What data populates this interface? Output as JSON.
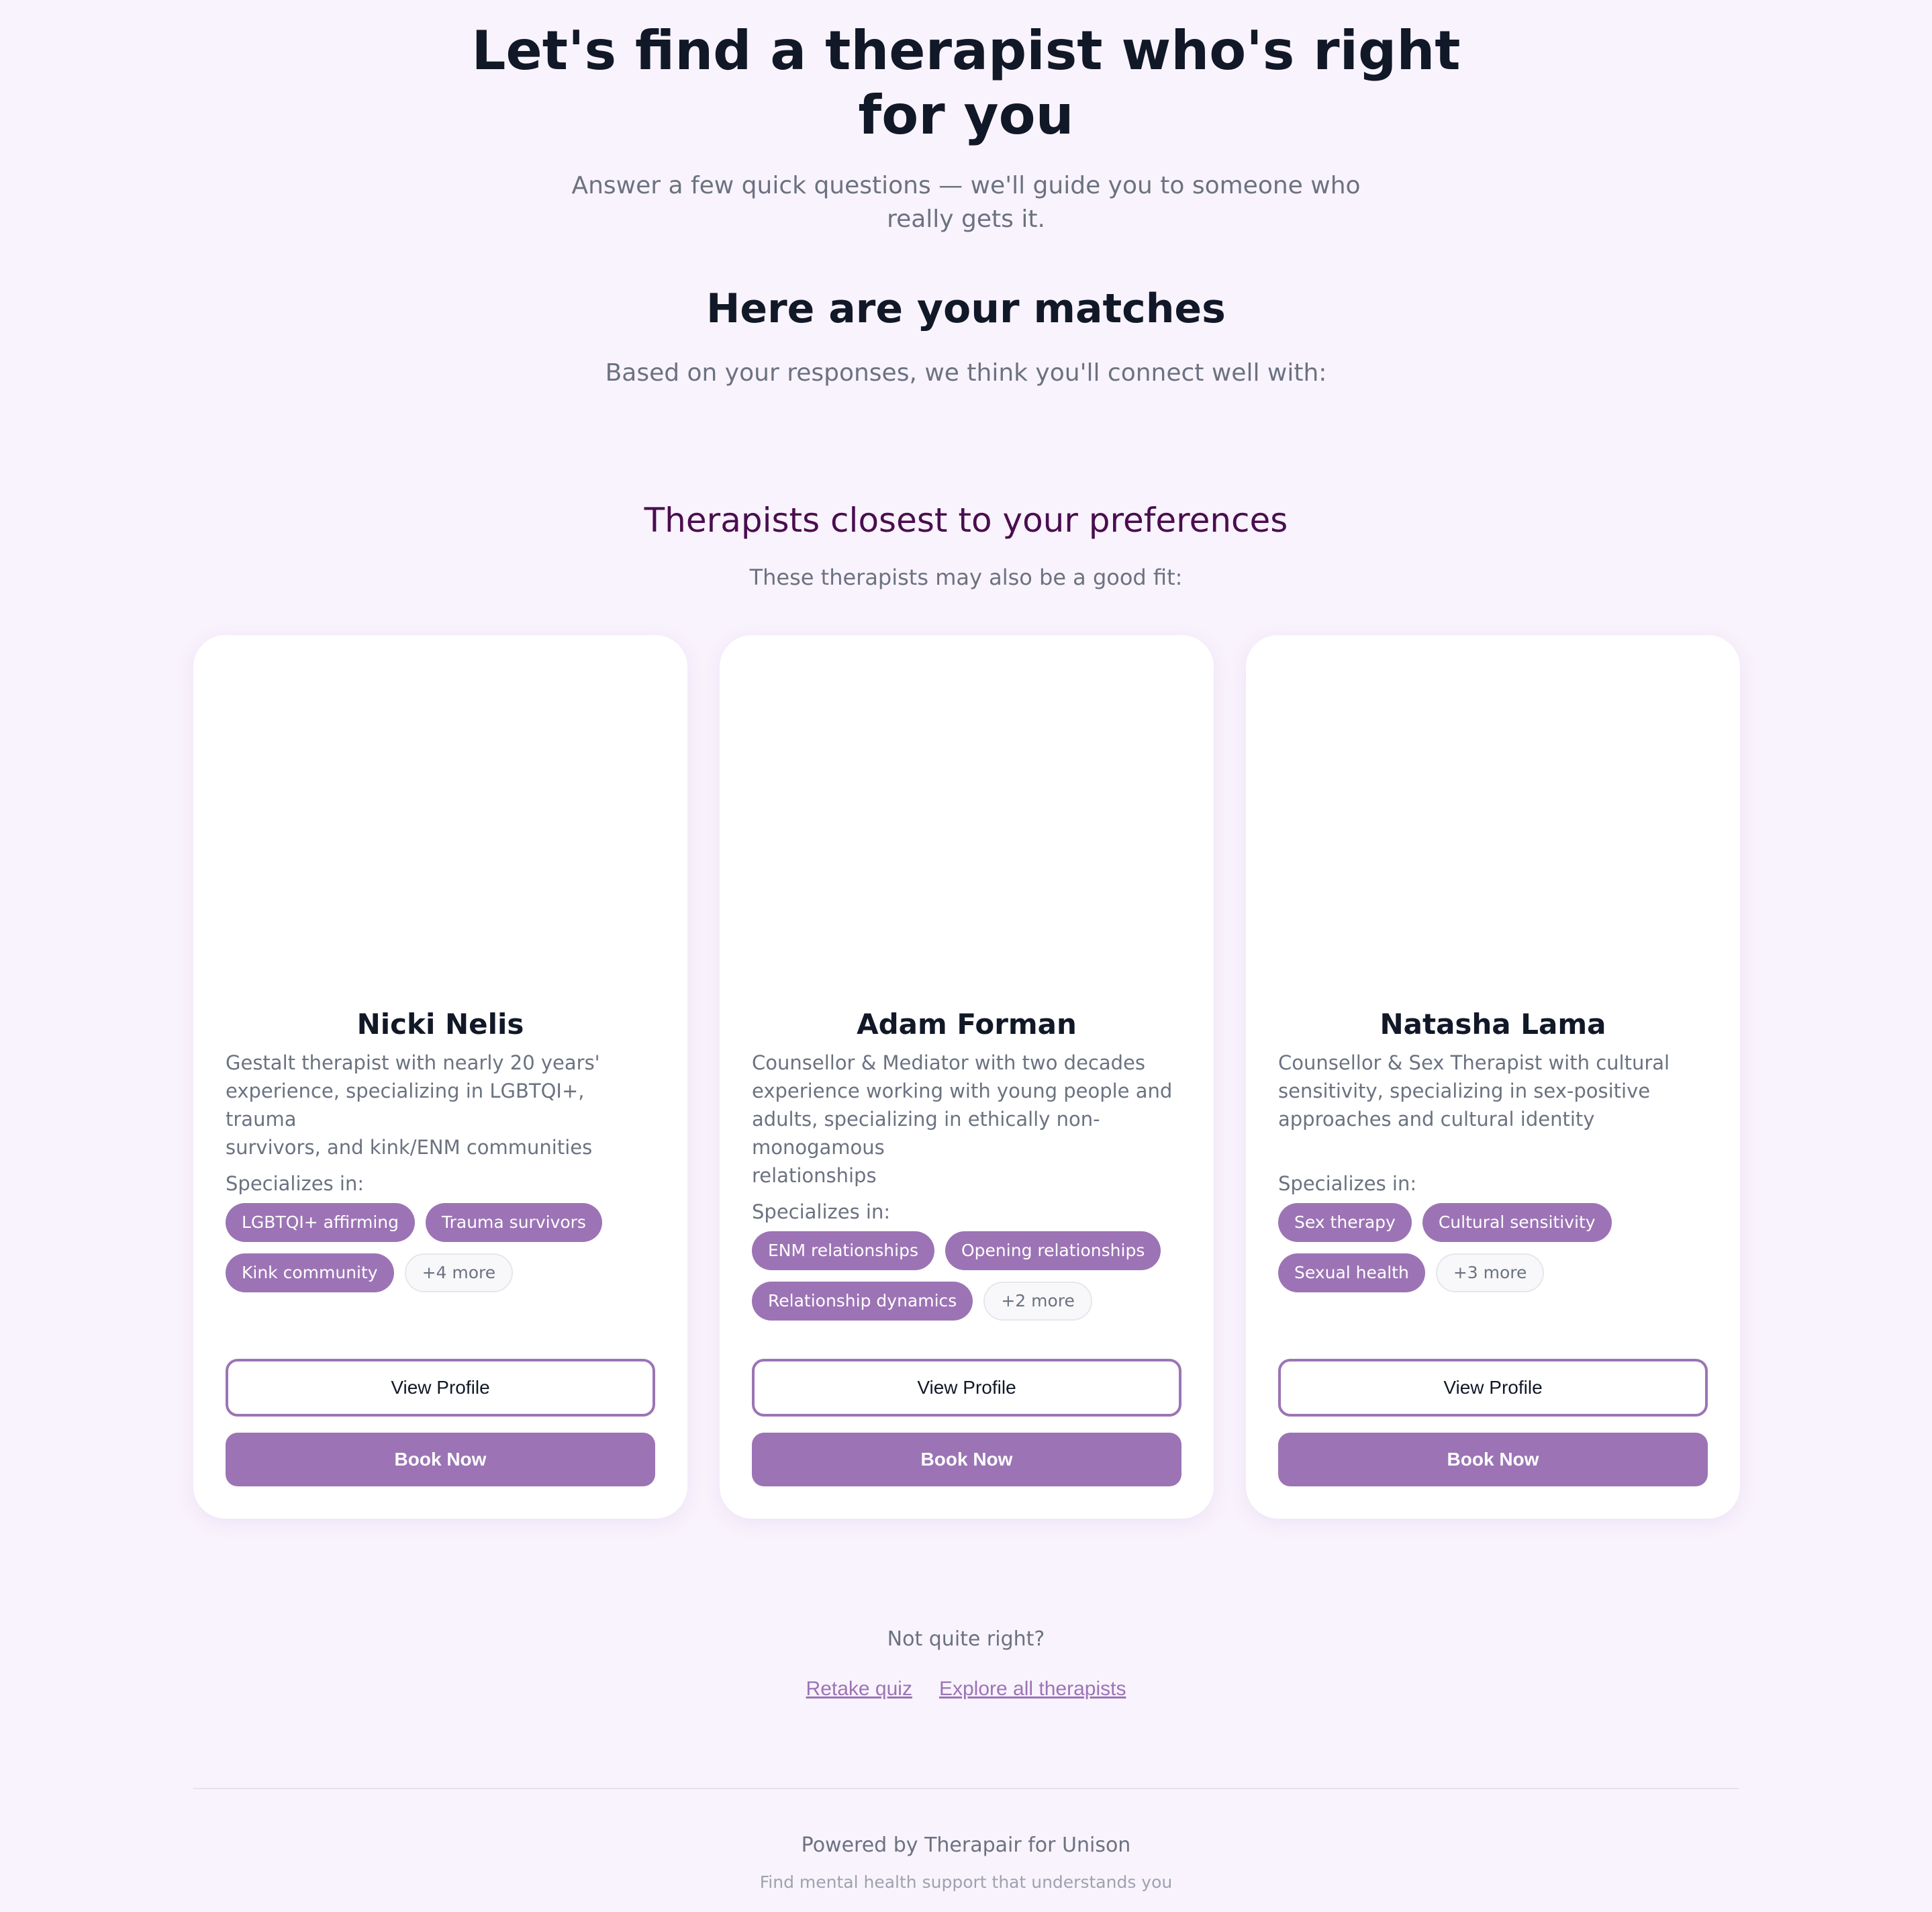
{
  "hero": {
    "title_line1": "Let's find a therapist who's right",
    "title_line2": "for you",
    "subtitle_line1": "Answer a few quick questions — we'll guide you to someone who",
    "subtitle_line2": "really gets it."
  },
  "matches": {
    "title": "Here are your matches",
    "subtitle": "Based on your responses, we think you'll connect well with:"
  },
  "closest": {
    "title": "Therapists closest to your preferences",
    "subtitle": "These therapists may also be a good fit:"
  },
  "therapists": [
    {
      "name": "Nicki Nelis",
      "desc_lines": [
        "Gestalt therapist with nearly 20 years'",
        "experience, specializing in LGBTQI+, trauma",
        "survivors, and kink/ENM communities"
      ],
      "specializes_label": "Specializes in:",
      "tags_row1": [
        "LGBTQI+ affirming",
        "Trauma survivors"
      ],
      "tags_row2": [
        "Kink community"
      ],
      "more": "+4 more",
      "view_label": "View Profile",
      "book_label": "Book Now"
    },
    {
      "name": "Adam Forman",
      "desc_lines": [
        "Counsellor & Mediator with two decades",
        "experience working with young people and",
        "adults, specializing in ethically non-monogamous",
        "relationships"
      ],
      "specializes_label": "Specializes in:",
      "tags_row1": [
        "ENM relationships",
        "Opening relationships"
      ],
      "tags_row2": [
        "Relationship dynamics"
      ],
      "more": "+2 more",
      "view_label": "View Profile",
      "book_label": "Book Now"
    },
    {
      "name": "Natasha Lama",
      "desc_lines": [
        "Counsellor & Sex Therapist with cultural",
        "sensitivity, specializing in sex-positive",
        "approaches and cultural identity"
      ],
      "specializes_label": "Specializes in:",
      "tags_row1": [
        "Sex therapy",
        "Cultural sensitivity"
      ],
      "tags_row2": [
        "Sexual health"
      ],
      "more": "+3 more",
      "view_label": "View Profile",
      "book_label": "Book Now"
    }
  ],
  "footer_actions": {
    "prompt": "Not quite right?",
    "retake": "Retake quiz",
    "explore": "Explore all therapists"
  },
  "footer": {
    "powered": "Powered by Therapair for Unison",
    "tagline": "Find mental health support that understands you"
  },
  "colors": {
    "background": "#f9f3fd",
    "accent": "#9c74b5",
    "heading_plum": "#4a0d4f",
    "text_dark": "#111827",
    "text_muted": "#6b7280"
  }
}
